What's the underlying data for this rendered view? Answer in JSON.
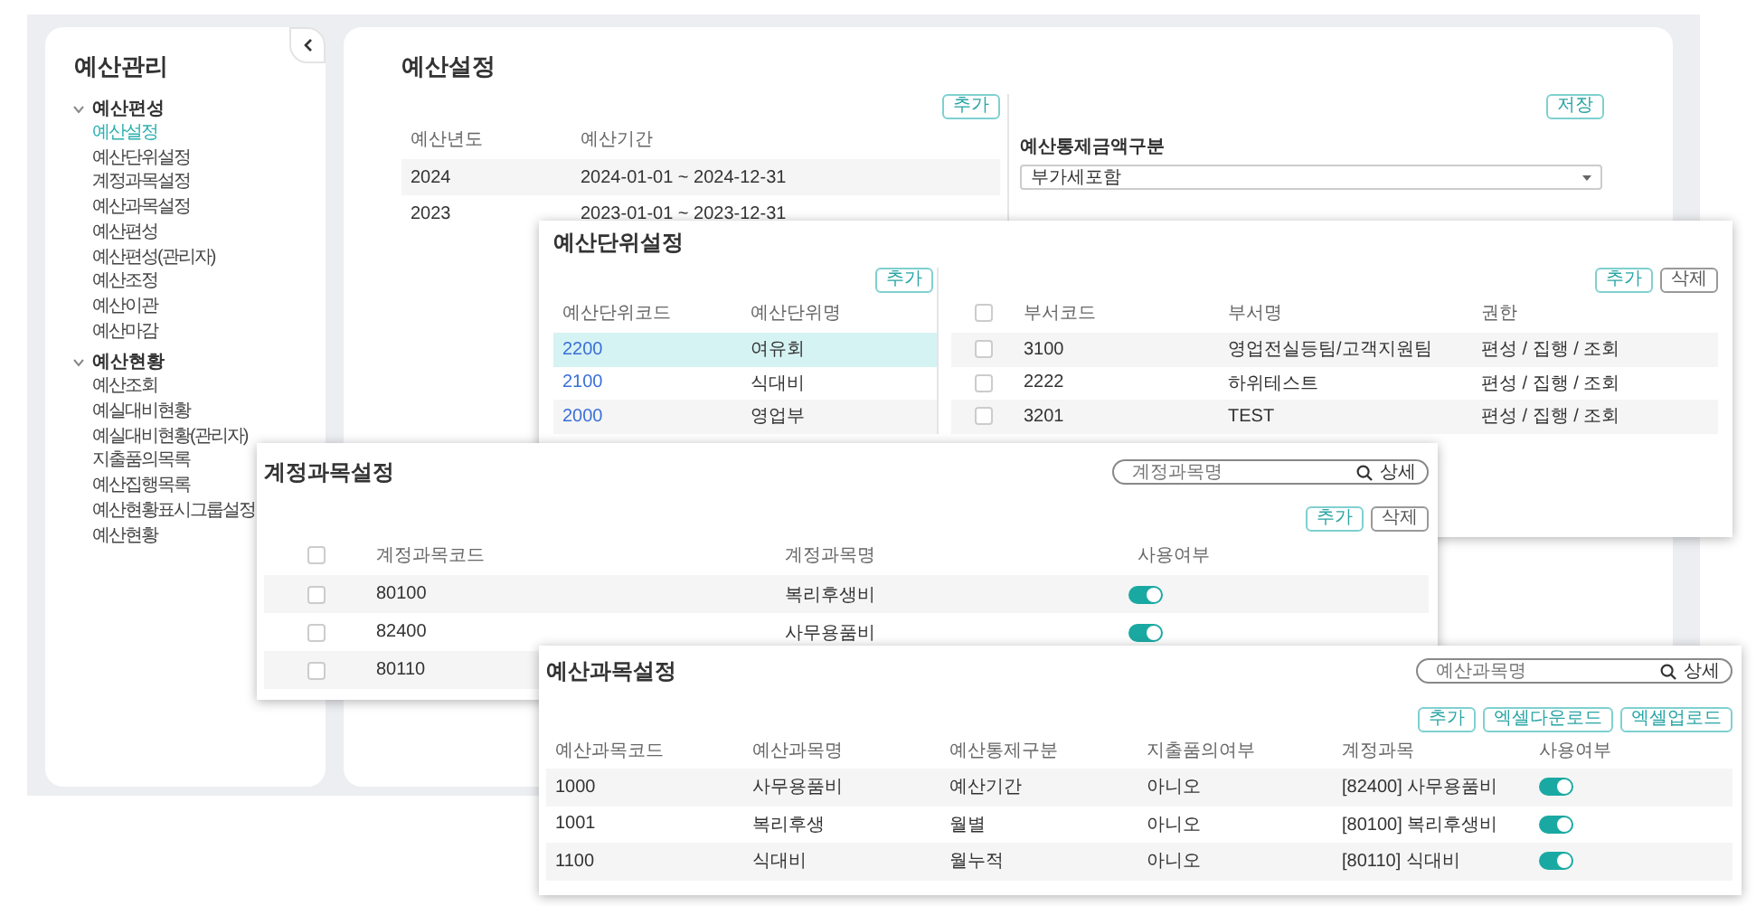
{
  "sidebar": {
    "title": "예산관리",
    "groups": [
      {
        "label": "예산편성",
        "expanded": true,
        "items": [
          {
            "label": "예산설정",
            "selected": true
          },
          {
            "label": "예산단위설정",
            "selected": false
          },
          {
            "label": "계정과목설정",
            "selected": false
          },
          {
            "label": "예산과목설정",
            "selected": false
          },
          {
            "label": "예산편성",
            "selected": false
          },
          {
            "label": "예산편성(관리자)",
            "selected": false
          },
          {
            "label": "예산조정",
            "selected": false
          },
          {
            "label": "예산이관",
            "selected": false
          },
          {
            "label": "예산마감",
            "selected": false
          }
        ]
      },
      {
        "label": "예산현황",
        "expanded": true,
        "items": [
          {
            "label": "예산조회",
            "selected": false
          },
          {
            "label": "예실대비현황",
            "selected": false
          },
          {
            "label": "예실대비현황(관리자)",
            "selected": false
          },
          {
            "label": "지출품의목록",
            "selected": false
          },
          {
            "label": "예산집행목록",
            "selected": false
          },
          {
            "label": "예산현황표시그룹설정",
            "selected": false
          },
          {
            "label": "예산현황",
            "selected": false
          }
        ]
      }
    ]
  },
  "budget_settings": {
    "title": "예산설정",
    "add_button": "추가",
    "columns": [
      "예산년도",
      "예산기간"
    ],
    "rows": [
      {
        "year": "2024",
        "period": "2024-01-01 ~ 2024-12-31"
      },
      {
        "year": "2023",
        "period": "2023-01-01 ~ 2023-12-31"
      }
    ],
    "save_button": "저장",
    "control_label": "예산통제금액구분",
    "control_value": "부가세포함"
  },
  "unit_window": {
    "title": "예산단위설정",
    "add_button": "추가",
    "columns": [
      "예산단위코드",
      "예산단위명"
    ],
    "rows": [
      {
        "code": "2200",
        "name": "여유회",
        "selected": true
      },
      {
        "code": "2100",
        "name": "식대비",
        "selected": false
      },
      {
        "code": "2000",
        "name": "영업부",
        "selected": false
      }
    ],
    "dept_buttons": [
      "추가",
      "삭제"
    ],
    "dept_header_checked": false,
    "dept_columns": [
      "부서코드",
      "부서명",
      "권한"
    ],
    "dept_rows": [
      {
        "checked": false,
        "code": "3100",
        "name": "영업전실등팀/고객지원팀",
        "rights": "편성 / 집행 / 조회"
      },
      {
        "checked": false,
        "code": "2222",
        "name": "하위테스트",
        "rights": "편성 / 집행 / 조회"
      },
      {
        "checked": false,
        "code": "3201",
        "name": "TEST",
        "rights": "편성 / 집행 / 조회"
      }
    ]
  },
  "account_window": {
    "title": "계정과목설정",
    "search": {
      "placeholder": "계정과목명"
    },
    "detail_button": "상세",
    "buttons": [
      "추가",
      "삭제"
    ],
    "header_checked": false,
    "columns": [
      "계정과목코드",
      "계정과목명",
      "사용여부"
    ],
    "rows": [
      {
        "checked": false,
        "code": "80100",
        "name": "복리후생비",
        "on": true
      },
      {
        "checked": false,
        "code": "82400",
        "name": "사무용품비",
        "on": true
      },
      {
        "checked": false,
        "code": "80110"
      }
    ]
  },
  "item_window": {
    "title": "예산과목설정",
    "search": {
      "placeholder": "예산과목명"
    },
    "detail_button": "상세",
    "buttons": [
      "추가",
      "엑셀다운로드",
      "엑셀업로드"
    ],
    "columns": [
      "예산과목코드",
      "예산과목명",
      "예산통제구분",
      "지출품의여부",
      "계정과목",
      "사용여부"
    ],
    "rows": [
      {
        "code": "1000",
        "name": "사무용품비",
        "control": "예산기간",
        "approval": "아니오",
        "account": "[82400] 사무용품비",
        "on": true
      },
      {
        "code": "1001",
        "name": "복리후생",
        "control": "월별",
        "approval": "아니오",
        "account": "[80100] 복리후생비",
        "on": true
      },
      {
        "code": "1100",
        "name": "식대비",
        "control": "월누적",
        "approval": "아니오",
        "account": "[80110] 식대비",
        "on": true
      }
    ]
  }
}
